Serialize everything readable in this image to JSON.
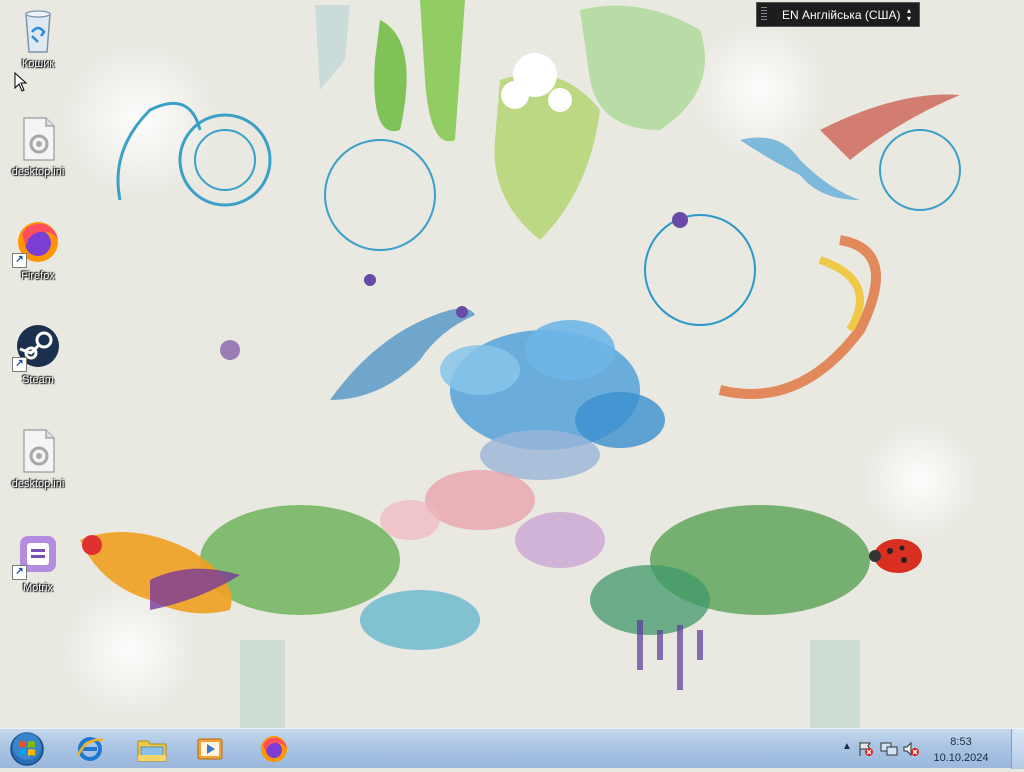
{
  "desktop": {
    "icons": [
      {
        "label": "Кошик",
        "icon": "recycle-bin-icon",
        "shortcut": false
      },
      {
        "label": "desktop.ini",
        "icon": "settings-file-icon",
        "shortcut": false
      },
      {
        "label": "Firefox",
        "icon": "firefox-icon",
        "shortcut": true
      },
      {
        "label": "Steam",
        "icon": "steam-icon",
        "shortcut": true
      },
      {
        "label": "desktop.ini",
        "icon": "settings-file-icon",
        "shortcut": false
      },
      {
        "label": "Motrix",
        "icon": "motrix-icon",
        "shortcut": true
      }
    ]
  },
  "language_bar": {
    "text": "EN Англійська (США)"
  },
  "taskbar": {
    "start_icon": "windows-start-icon",
    "pinned": [
      {
        "name": "internet-explorer",
        "icon": "internet-explorer-icon"
      },
      {
        "name": "windows-explorer",
        "icon": "folder-icon"
      },
      {
        "name": "media-player",
        "icon": "media-player-icon"
      },
      {
        "name": "firefox",
        "icon": "firefox-icon"
      }
    ],
    "tray": {
      "show_hidden_icon": "chevron-up-icon",
      "icons": [
        "action-center-icon",
        "network-icon",
        "volume-muted-icon"
      ],
      "show_hidden_text": "▲"
    },
    "clock": {
      "time": "8:53",
      "date": "10.10.2024"
    }
  },
  "colors": {
    "taskbar": "#a9c4e3",
    "desktop_background": "#e9e8e1",
    "language_bar": "#1d1d1d"
  }
}
